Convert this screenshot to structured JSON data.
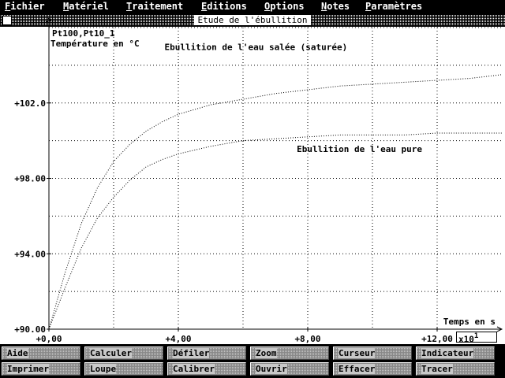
{
  "menu": [
    {
      "label": "Fichier",
      "key": "F"
    },
    {
      "label": "Matériel",
      "key": "M"
    },
    {
      "label": "Traitement",
      "key": "T"
    },
    {
      "label": "Editions",
      "key": "E"
    },
    {
      "label": "Options",
      "key": "O"
    },
    {
      "label": "Notes",
      "key": "N"
    },
    {
      "label": "Paramètres",
      "key": "P"
    }
  ],
  "window": {
    "title": "Etude de l'ébullition"
  },
  "chart_data": {
    "type": "line",
    "title": "",
    "ylabel_line1": "Pt100,Pt10_1",
    "ylabel_line2": "Température en °C",
    "xlabel": "Temps en s",
    "x_multiplier": "x10",
    "x_multiplier_exp": "1",
    "xlim": [
      0,
      14
    ],
    "ylim": [
      90,
      106
    ],
    "x_ticks": [
      0,
      4,
      8,
      12
    ],
    "x_tick_labels": [
      "+0,00",
      "+4,00",
      "+8,00",
      "+12,00"
    ],
    "y_ticks": [
      90,
      94,
      98,
      102
    ],
    "y_tick_labels": [
      "+90.00",
      "+94.00",
      "+98.00",
      "+102.0"
    ],
    "grid": true,
    "series": [
      {
        "name": "Ebullition de l'eau salée (saturée)",
        "x": [
          0,
          0.5,
          1,
          1.5,
          2,
          2.5,
          3,
          3.5,
          4,
          5,
          6,
          7,
          8,
          9,
          10,
          11,
          12,
          13,
          14
        ],
        "y": [
          90.0,
          93.0,
          95.6,
          97.5,
          98.9,
          99.8,
          100.5,
          101.0,
          101.4,
          101.9,
          102.2,
          102.5,
          102.7,
          102.9,
          103.0,
          103.1,
          103.2,
          103.3,
          103.5
        ]
      },
      {
        "name": "Ebullition de l'eau pure",
        "x": [
          0,
          0.5,
          1,
          1.5,
          2,
          2.5,
          3,
          3.5,
          4,
          5,
          6,
          7,
          8,
          9,
          10,
          11,
          12,
          13,
          14
        ],
        "y": [
          90.0,
          92.2,
          94.3,
          95.9,
          97.0,
          97.9,
          98.6,
          99.0,
          99.3,
          99.7,
          100.0,
          100.1,
          100.2,
          100.3,
          100.3,
          100.3,
          100.4,
          100.4,
          100.4
        ]
      }
    ]
  },
  "toolbar": {
    "row1": [
      "Aide",
      "Calculer",
      "Défiler",
      "Zoom",
      "Curseur",
      "Indicateur"
    ],
    "row2": [
      "Imprimer",
      "Loupe",
      "Calibrer",
      "Ouvrir",
      "Effacer",
      "Tracer"
    ]
  }
}
